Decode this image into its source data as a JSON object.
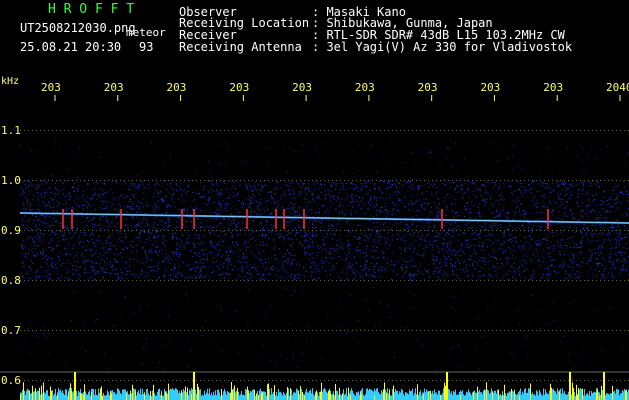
{
  "header": {
    "app_title": "H R O F F T",
    "filename": "UT2508212030.png",
    "mode": "meteor",
    "date_time": "25.08.21 20:30",
    "count": "93",
    "labels": {
      "observer": "Observer",
      "location": "Receiving Location",
      "receiver": "Receiver",
      "antenna": "Receiving Antenna"
    },
    "values": {
      "observer": ": Masaki Kano",
      "location": ": Shibukawa, Gunma, Japan",
      "receiver": ": RTL-SDR SDR# 43dB L15 103.2MHz CW",
      "antenna": ": 3el Yagi(V) Az 330 for Vladivostok"
    }
  },
  "colors": {
    "background": "#000000",
    "title_green": "#33ff33",
    "axis_yellow": "#ffff66",
    "spectrum_blue": "#2233cc",
    "echo_red": "#ff3333",
    "bottom_cyan": "#33ccff",
    "bottom_yellow": "#ffff00"
  },
  "chart_data": {
    "type": "heatmap",
    "y_unit_label": "kHz",
    "y_ticks": [
      "1.1",
      "1.0",
      "0.9",
      "0.8",
      "0.7",
      "0.6"
    ],
    "time_ticks": [
      "203",
      "203",
      "203",
      "203",
      "203",
      "203",
      "203",
      "203",
      "203",
      "2040"
    ],
    "ylim": [
      0.6,
      1.1
    ],
    "signal_band_khz": [
      0.8,
      1.0
    ],
    "carrier_khz": 0.93
  }
}
